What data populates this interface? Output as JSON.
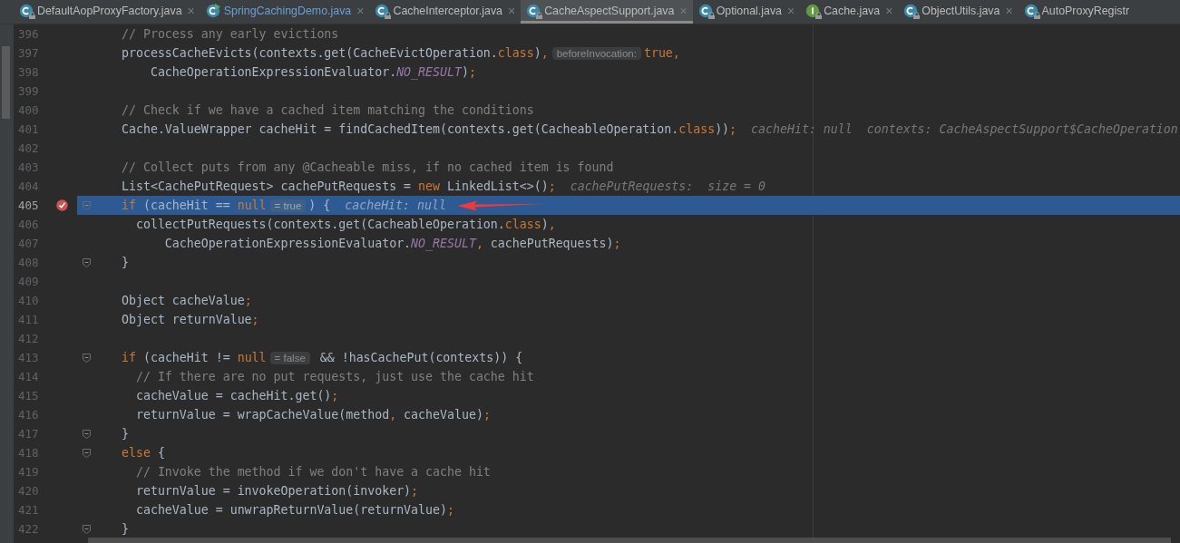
{
  "tabs": [
    {
      "label": "DefaultAopProxyFactory.java",
      "kind": "class",
      "locked": true,
      "modified": false,
      "selected": false,
      "close": "×"
    },
    {
      "label": "SpringCachingDemo.java",
      "kind": "runnable-class",
      "locked": false,
      "modified": true,
      "selected": false,
      "close": "×"
    },
    {
      "label": "CacheInterceptor.java",
      "kind": "class",
      "locked": true,
      "modified": false,
      "selected": false,
      "close": "×"
    },
    {
      "label": "CacheAspectSupport.java",
      "kind": "class",
      "locked": true,
      "modified": false,
      "selected": true,
      "close": "×"
    },
    {
      "label": "Optional.java",
      "kind": "class",
      "locked": true,
      "modified": false,
      "selected": false,
      "close": "×"
    },
    {
      "label": "Cache.java",
      "kind": "interface",
      "locked": true,
      "modified": false,
      "selected": false,
      "close": "×"
    },
    {
      "label": "ObjectUtils.java",
      "kind": "class",
      "locked": true,
      "modified": false,
      "selected": false,
      "close": "×"
    },
    {
      "label": "AutoProxyRegistr",
      "kind": "class",
      "locked": true,
      "modified": false,
      "selected": false
    }
  ],
  "lines": [
    {
      "number": "396",
      "current": false,
      "breakpoint": false,
      "fold": false,
      "arrow": false,
      "segments": [
        {
          "kind": "code",
          "tokens": [
            {
              "kind": "comment",
              "text": "// Process any early evictions"
            }
          ]
        }
      ]
    },
    {
      "number": "397",
      "current": false,
      "breakpoint": false,
      "fold": false,
      "arrow": false,
      "segments": [
        {
          "kind": "code",
          "tokens": [
            {
              "kind": "plain",
              "text": "processCacheEvicts(contexts.get(CacheEvictOperation."
            },
            {
              "kind": "keyword",
              "text": "class"
            },
            {
              "kind": "plain",
              "text": ")"
            },
            {
              "kind": "keyword",
              "text": ","
            }
          ]
        },
        {
          "kind": "inlay",
          "text": "beforeInvocation:"
        },
        {
          "kind": "code",
          "tokens": [
            {
              "kind": "keyword",
              "text": "true,"
            }
          ]
        }
      ]
    },
    {
      "number": "398",
      "current": false,
      "breakpoint": false,
      "fold": false,
      "arrow": false,
      "segments": [
        {
          "kind": "code",
          "tokens": [
            {
              "kind": "plain",
              "text": "    CacheOperationExpressionEvaluator."
            },
            {
              "kind": "static",
              "text": "NO_RESULT"
            },
            {
              "kind": "plain",
              "text": ")"
            },
            {
              "kind": "keyword",
              "text": ";"
            }
          ]
        }
      ]
    },
    {
      "number": "399",
      "current": false,
      "breakpoint": false,
      "fold": false,
      "arrow": false
    },
    {
      "number": "400",
      "current": false,
      "breakpoint": false,
      "fold": false,
      "arrow": false,
      "segments": [
        {
          "kind": "code",
          "tokens": [
            {
              "kind": "comment",
              "text": "// Check if we have a cached item matching the conditions"
            }
          ]
        }
      ]
    },
    {
      "number": "401",
      "current": false,
      "breakpoint": false,
      "fold": false,
      "arrow": false,
      "segments": [
        {
          "kind": "code",
          "tokens": [
            {
              "kind": "plain",
              "text": "Cache.ValueWrapper cacheHit = findCachedItem(contexts.get(CacheableOperation."
            },
            {
              "kind": "keyword",
              "text": "class"
            },
            {
              "kind": "plain",
              "text": "))"
            },
            {
              "kind": "keyword",
              "text": ";"
            }
          ]
        },
        {
          "kind": "hint",
          "text": "cacheHit: null"
        },
        {
          "kind": "hint",
          "text": "contexts: CacheAspectSupport$CacheOperation"
        }
      ]
    },
    {
      "number": "402",
      "current": false,
      "breakpoint": false,
      "fold": false,
      "arrow": false
    },
    {
      "number": "403",
      "current": false,
      "breakpoint": false,
      "fold": false,
      "arrow": false,
      "segments": [
        {
          "kind": "code",
          "tokens": [
            {
              "kind": "comment",
              "text": "// Collect puts from any @Cacheable miss, if no cached item is found"
            }
          ]
        }
      ]
    },
    {
      "number": "404",
      "current": false,
      "breakpoint": false,
      "fold": false,
      "arrow": false,
      "segments": [
        {
          "kind": "code",
          "tokens": [
            {
              "kind": "plain",
              "text": "List<CachePutRequest> cachePutRequests = "
            },
            {
              "kind": "keyword",
              "text": "new"
            },
            {
              "kind": "plain",
              "text": " LinkedList<>()"
            },
            {
              "kind": "keyword",
              "text": ";"
            }
          ]
        },
        {
          "kind": "hint",
          "text": "cachePutRequests:  size = 0"
        }
      ]
    },
    {
      "number": "405",
      "current": true,
      "breakpoint": true,
      "fold": true,
      "arrow": true,
      "segments": [
        {
          "kind": "code",
          "tokens": [
            {
              "kind": "keyword",
              "text": "if"
            },
            {
              "kind": "plain",
              "text": " (cacheHit == "
            },
            {
              "kind": "keyword",
              "text": "null"
            }
          ]
        },
        {
          "kind": "inlay",
          "text": "= true"
        },
        {
          "kind": "code",
          "tokens": [
            {
              "kind": "plain",
              "text": ") {"
            }
          ]
        },
        {
          "kind": "hint",
          "text": "cacheHit: null"
        }
      ]
    },
    {
      "number": "406",
      "current": false,
      "breakpoint": false,
      "fold": false,
      "arrow": false,
      "segments": [
        {
          "kind": "code",
          "tokens": [
            {
              "kind": "plain",
              "text": "  collectPutRequests(contexts.get(CacheableOperation."
            },
            {
              "kind": "keyword",
              "text": "class"
            },
            {
              "kind": "plain",
              "text": ")"
            },
            {
              "kind": "keyword",
              "text": ","
            }
          ]
        }
      ]
    },
    {
      "number": "407",
      "current": false,
      "breakpoint": false,
      "fold": false,
      "arrow": false,
      "segments": [
        {
          "kind": "code",
          "tokens": [
            {
              "kind": "plain",
              "text": "      CacheOperationExpressionEvaluator."
            },
            {
              "kind": "static",
              "text": "NO_RESULT"
            },
            {
              "kind": "keyword",
              "text": ","
            },
            {
              "kind": "plain",
              "text": " cachePutRequests)"
            },
            {
              "kind": "keyword",
              "text": ";"
            }
          ]
        }
      ]
    },
    {
      "number": "408",
      "current": false,
      "breakpoint": false,
      "fold": true,
      "arrow": false,
      "segments": [
        {
          "kind": "code",
          "tokens": [
            {
              "kind": "plain",
              "text": "}"
            }
          ]
        }
      ]
    },
    {
      "number": "409",
      "current": false,
      "breakpoint": false,
      "fold": false,
      "arrow": false
    },
    {
      "number": "410",
      "current": false,
      "breakpoint": false,
      "fold": false,
      "arrow": false,
      "segments": [
        {
          "kind": "code",
          "tokens": [
            {
              "kind": "plain",
              "text": "Object cacheValue"
            },
            {
              "kind": "keyword",
              "text": ";"
            }
          ]
        }
      ]
    },
    {
      "number": "411",
      "current": false,
      "breakpoint": false,
      "fold": false,
      "arrow": false,
      "segments": [
        {
          "kind": "code",
          "tokens": [
            {
              "kind": "plain",
              "text": "Object returnValue"
            },
            {
              "kind": "keyword",
              "text": ";"
            }
          ]
        }
      ]
    },
    {
      "number": "412",
      "current": false,
      "breakpoint": false,
      "fold": false,
      "arrow": false
    },
    {
      "number": "413",
      "current": false,
      "breakpoint": false,
      "fold": true,
      "arrow": false,
      "segments": [
        {
          "kind": "code",
          "tokens": [
            {
              "kind": "keyword",
              "text": "if"
            },
            {
              "kind": "plain",
              "text": " (cacheHit != "
            },
            {
              "kind": "keyword",
              "text": "null"
            }
          ]
        },
        {
          "kind": "inlay",
          "text": "= false"
        },
        {
          "kind": "code",
          "tokens": [
            {
              "kind": "plain",
              "text": " && !hasCachePut(contexts)) {"
            }
          ]
        }
      ]
    },
    {
      "number": "414",
      "current": false,
      "breakpoint": false,
      "fold": false,
      "arrow": false,
      "segments": [
        {
          "kind": "code",
          "tokens": [
            {
              "kind": "comment",
              "text": "  // If there are no put requests, just use the cache hit"
            }
          ]
        }
      ]
    },
    {
      "number": "415",
      "current": false,
      "breakpoint": false,
      "fold": false,
      "arrow": false,
      "segments": [
        {
          "kind": "code",
          "tokens": [
            {
              "kind": "plain",
              "text": "  cacheValue = cacheHit.get()"
            },
            {
              "kind": "keyword",
              "text": ";"
            }
          ]
        }
      ]
    },
    {
      "number": "416",
      "current": false,
      "breakpoint": false,
      "fold": false,
      "arrow": false,
      "segments": [
        {
          "kind": "code",
          "tokens": [
            {
              "kind": "plain",
              "text": "  returnValue = wrapCacheValue(method"
            },
            {
              "kind": "keyword",
              "text": ","
            },
            {
              "kind": "plain",
              "text": " cacheValue)"
            },
            {
              "kind": "keyword",
              "text": ";"
            }
          ]
        }
      ]
    },
    {
      "number": "417",
      "current": false,
      "breakpoint": false,
      "fold": true,
      "arrow": false,
      "segments": [
        {
          "kind": "code",
          "tokens": [
            {
              "kind": "plain",
              "text": "}"
            }
          ]
        }
      ]
    },
    {
      "number": "418",
      "current": false,
      "breakpoint": false,
      "fold": true,
      "arrow": false,
      "segments": [
        {
          "kind": "code",
          "tokens": [
            {
              "kind": "keyword",
              "text": "else"
            },
            {
              "kind": "plain",
              "text": " {"
            }
          ]
        }
      ]
    },
    {
      "number": "419",
      "current": false,
      "breakpoint": false,
      "fold": false,
      "arrow": false,
      "segments": [
        {
          "kind": "code",
          "tokens": [
            {
              "kind": "comment",
              "text": "  // Invoke the method if we don't have a cache hit"
            }
          ]
        }
      ]
    },
    {
      "number": "420",
      "current": false,
      "breakpoint": false,
      "fold": false,
      "arrow": false,
      "segments": [
        {
          "kind": "code",
          "tokens": [
            {
              "kind": "plain",
              "text": "  returnValue = invokeOperation(invoker)"
            },
            {
              "kind": "keyword",
              "text": ";"
            }
          ]
        }
      ]
    },
    {
      "number": "421",
      "current": false,
      "breakpoint": false,
      "fold": false,
      "arrow": false,
      "segments": [
        {
          "kind": "code",
          "tokens": [
            {
              "kind": "plain",
              "text": "  cacheValue = unwrapReturnValue(returnValue)"
            },
            {
              "kind": "keyword",
              "text": ";"
            }
          ]
        }
      ]
    },
    {
      "number": "422",
      "current": false,
      "breakpoint": false,
      "fold": true,
      "arrow": false,
      "segments": [
        {
          "kind": "code",
          "tokens": [
            {
              "kind": "plain",
              "text": "}"
            }
          ]
        }
      ]
    }
  ]
}
